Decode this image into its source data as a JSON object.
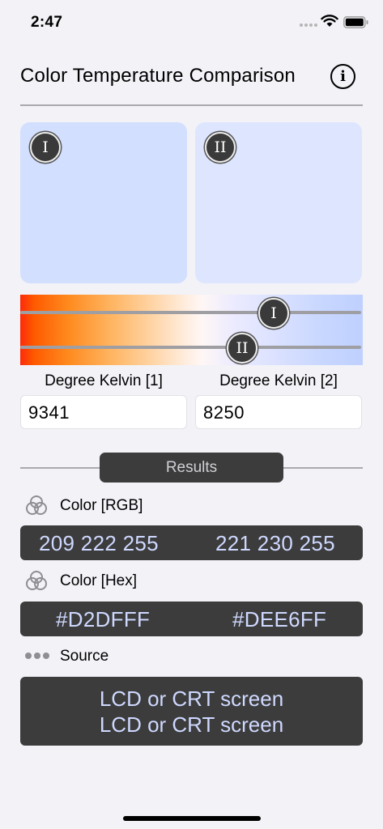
{
  "status_bar": {
    "time": "2:47"
  },
  "header": {
    "title": "Color Temperature Comparison",
    "info_icon": "info-circle-icon"
  },
  "swatches": [
    {
      "badge": "I",
      "color": "#D2DFFF"
    },
    {
      "badge": "II",
      "color": "#DEE6FF"
    }
  ],
  "sliders": [
    {
      "badge": "I",
      "value_kelvin": 9341
    },
    {
      "badge": "II",
      "value_kelvin": 8250
    }
  ],
  "inputs": [
    {
      "label": "Degree Kelvin [1]",
      "value": "9341"
    },
    {
      "label": "Degree Kelvin [2]",
      "value": "8250"
    }
  ],
  "results": {
    "button_label": "Results",
    "rgb": {
      "label": "Color [RGB]",
      "icon": "color-circles-icon",
      "value_1": "209 222 255",
      "value_2": "221 230 255"
    },
    "hex": {
      "label": "Color [Hex]",
      "icon": "color-circles-icon",
      "value_1": "#D2DFFF",
      "value_2": "#DEE6FF"
    },
    "source": {
      "label": "Source",
      "icon": "ellipsis-icon",
      "line_1": "LCD or CRT screen",
      "line_2": "LCD or CRT screen"
    }
  },
  "colors": {
    "panel_dark": "#3C3C3C",
    "result_text": "#CFD9FF",
    "background": "#F2F2F7"
  }
}
